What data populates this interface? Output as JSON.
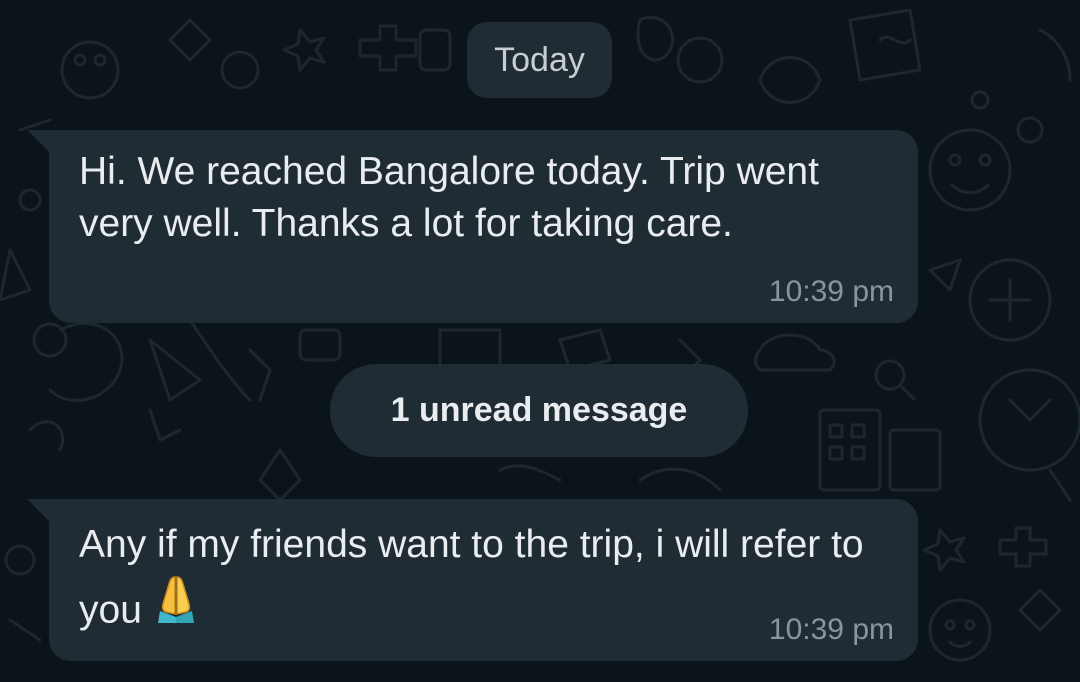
{
  "chat": {
    "date_separator": "Today",
    "unread_separator": "1 unread message",
    "messages": [
      {
        "text": "Hi. We reached Bangalore today. Trip went very well. Thanks a lot for taking care.",
        "time": "10:39 pm",
        "direction": "incoming"
      },
      {
        "text": "Any if my friends want to the trip, i will refer to you",
        "emoji_icon": "folded-hands-icon",
        "time": "10:39 pm",
        "direction": "incoming"
      }
    ]
  },
  "colors": {
    "background": "#0b141a",
    "bubble_incoming": "#202c33",
    "pill": "#1f2c34",
    "text_primary": "#e9edef",
    "text_secondary": "#8696a0",
    "wallpaper_doodle": "#1c272e"
  }
}
